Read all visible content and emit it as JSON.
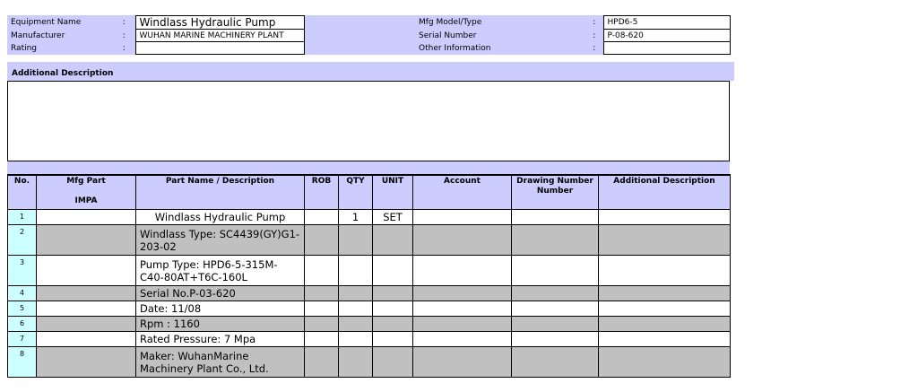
{
  "header": {
    "equipment_name_label": "Equipment Name",
    "equipment_name": "Windlass Hydraulic Pump",
    "manufacturer_label": "Manufacturer",
    "manufacturer": "WUHAN MARINE MACHINERY PLANT",
    "rating_label": "Rating",
    "rating": "",
    "model_label": "Mfg Model/Type",
    "model": "HPD6-5",
    "serial_label": "Serial Number",
    "serial": "P-08-620",
    "other_label": "Other Information",
    "other": "",
    "colon": ":"
  },
  "additional": {
    "label": "Additional Description",
    "text": ""
  },
  "parts_table": {
    "columns": {
      "no": "No.",
      "mfg_part": "Mfg Part",
      "impa": "IMPA",
      "part_name": "Part Name / Description",
      "rob": "ROB",
      "qty": "QTY",
      "unit": "UNIT",
      "account": "Account",
      "drawing": "Drawing Number Number",
      "additional": "Additional Description"
    },
    "rows": [
      {
        "no": "1",
        "mfg_part": "",
        "name": "Windlass Hydraulic Pump",
        "rob": "",
        "qty": "1",
        "unit": "SET",
        "account": "",
        "drawing": "",
        "additional": ""
      },
      {
        "no": "2",
        "mfg_part": "",
        "name": "Windlass Type: SC4439(GY)G1-203-02",
        "rob": "",
        "qty": "",
        "unit": "",
        "account": "",
        "drawing": "",
        "additional": ""
      },
      {
        "no": "3",
        "mfg_part": "",
        "name": "Pump Type: HPD6-5-315M-C40-80AT+T6C-160L",
        "rob": "",
        "qty": "",
        "unit": "",
        "account": "",
        "drawing": "",
        "additional": ""
      },
      {
        "no": "4",
        "mfg_part": "",
        "name": "Serial No.P-03-620",
        "rob": "",
        "qty": "",
        "unit": "",
        "account": "",
        "drawing": "",
        "additional": ""
      },
      {
        "no": "5",
        "mfg_part": "",
        "name": "Date: 11/08",
        "rob": "",
        "qty": "",
        "unit": "",
        "account": "",
        "drawing": "",
        "additional": ""
      },
      {
        "no": "6",
        "mfg_part": "",
        "name": "Rpm : 1160",
        "rob": "",
        "qty": "",
        "unit": "",
        "account": "",
        "drawing": "",
        "additional": ""
      },
      {
        "no": "7",
        "mfg_part": "",
        "name": "Rated Pressure: 7 Mpa",
        "rob": "",
        "qty": "",
        "unit": "",
        "account": "",
        "drawing": "",
        "additional": ""
      },
      {
        "no": "8",
        "mfg_part": "",
        "name": "Maker: WuhanMarine Machinery Plant Co., Ltd.",
        "rob": "",
        "qty": "",
        "unit": "",
        "account": "",
        "drawing": "",
        "additional": ""
      }
    ]
  }
}
